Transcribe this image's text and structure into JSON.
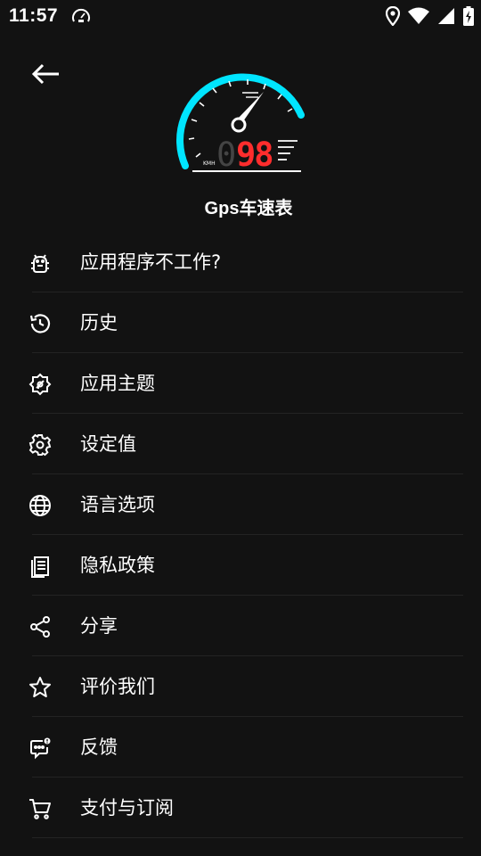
{
  "status_bar": {
    "time": "11:57",
    "icons": [
      "speedometer-icon",
      "location-icon",
      "wifi-icon",
      "signal-icon",
      "battery-icon"
    ]
  },
  "header": {
    "back_icon": "back-arrow-icon",
    "logo": {
      "unit": "KMH",
      "speed_faded": "0",
      "speed": "98",
      "ring_color": "#00e5ff",
      "digit_color": "#ff2d2d"
    },
    "app_title": "Gps车速表"
  },
  "menu": {
    "items": [
      {
        "label": "应用程序不工作?",
        "icon": "android-bug-icon"
      },
      {
        "label": "历史",
        "icon": "history-icon"
      },
      {
        "label": "应用主题",
        "icon": "theme-badge-icon"
      },
      {
        "label": "设定值",
        "icon": "settings-gear-icon"
      },
      {
        "label": "语言选项",
        "icon": "globe-icon"
      },
      {
        "label": "隐私政策",
        "icon": "document-icon"
      },
      {
        "label": "分享",
        "icon": "share-icon"
      },
      {
        "label": "评价我们",
        "icon": "star-icon"
      },
      {
        "label": "反馈",
        "icon": "feedback-icon"
      },
      {
        "label": "支付与订阅",
        "icon": "cart-icon"
      }
    ]
  }
}
